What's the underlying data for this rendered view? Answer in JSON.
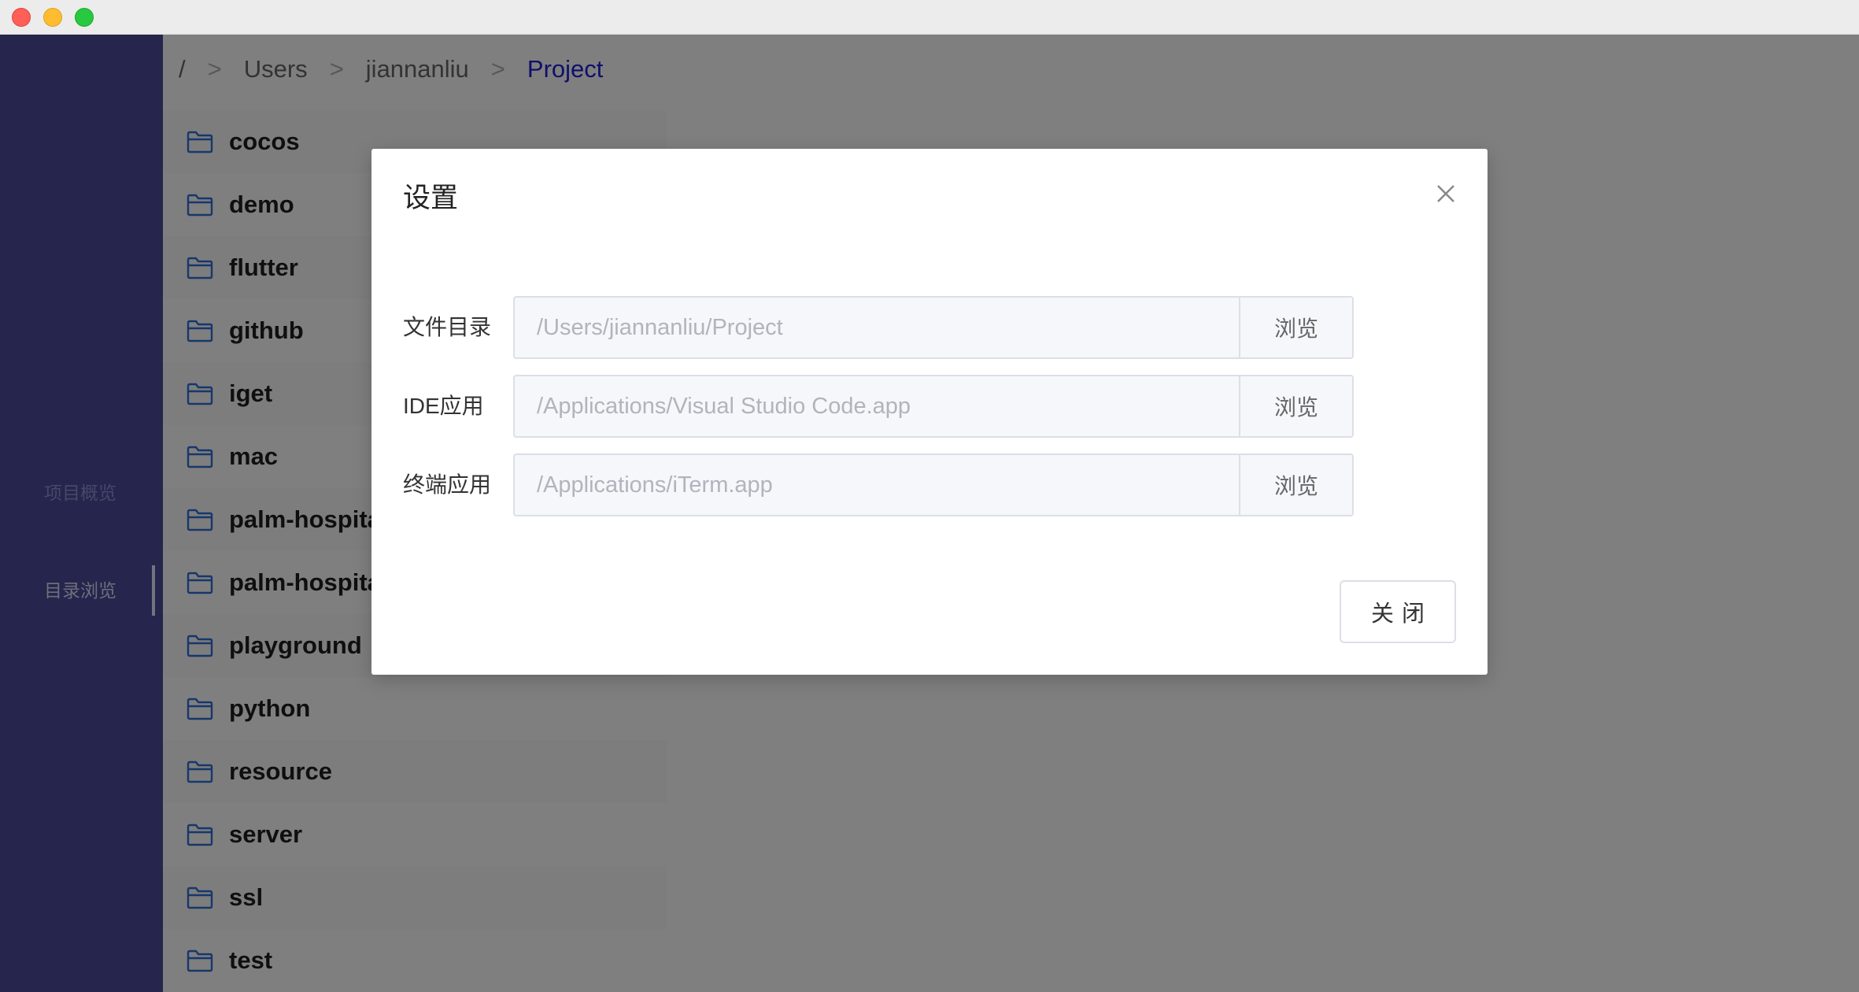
{
  "sidebar": {
    "items": [
      {
        "label": "项目概览"
      },
      {
        "label": "目录浏览"
      }
    ]
  },
  "breadcrumb": {
    "root": "/",
    "separator": ">",
    "items": [
      "Users",
      "jiannanliu",
      "Project"
    ]
  },
  "folders": [
    "cocos",
    "demo",
    "flutter",
    "github",
    "iget",
    "mac",
    "palm-hospita",
    "palm-hospita",
    "playground",
    "python",
    "resource",
    "server",
    "ssl",
    "test"
  ],
  "dialog": {
    "title": "设置",
    "fields": [
      {
        "label": "文件目录",
        "placeholder": "/Users/jiannanliu/Project",
        "button": "浏览"
      },
      {
        "label": "IDE应用",
        "placeholder": "/Applications/Visual Studio Code.app",
        "button": "浏览"
      },
      {
        "label": "终端应用",
        "placeholder": "/Applications/iTerm.app",
        "button": "浏览"
      }
    ],
    "close_button": "关闭"
  },
  "colors": {
    "sidebar_bg": "#4a4a9c",
    "breadcrumb_active": "#1f1fd6",
    "overlay": "rgba(0,0,0,0.5)"
  }
}
